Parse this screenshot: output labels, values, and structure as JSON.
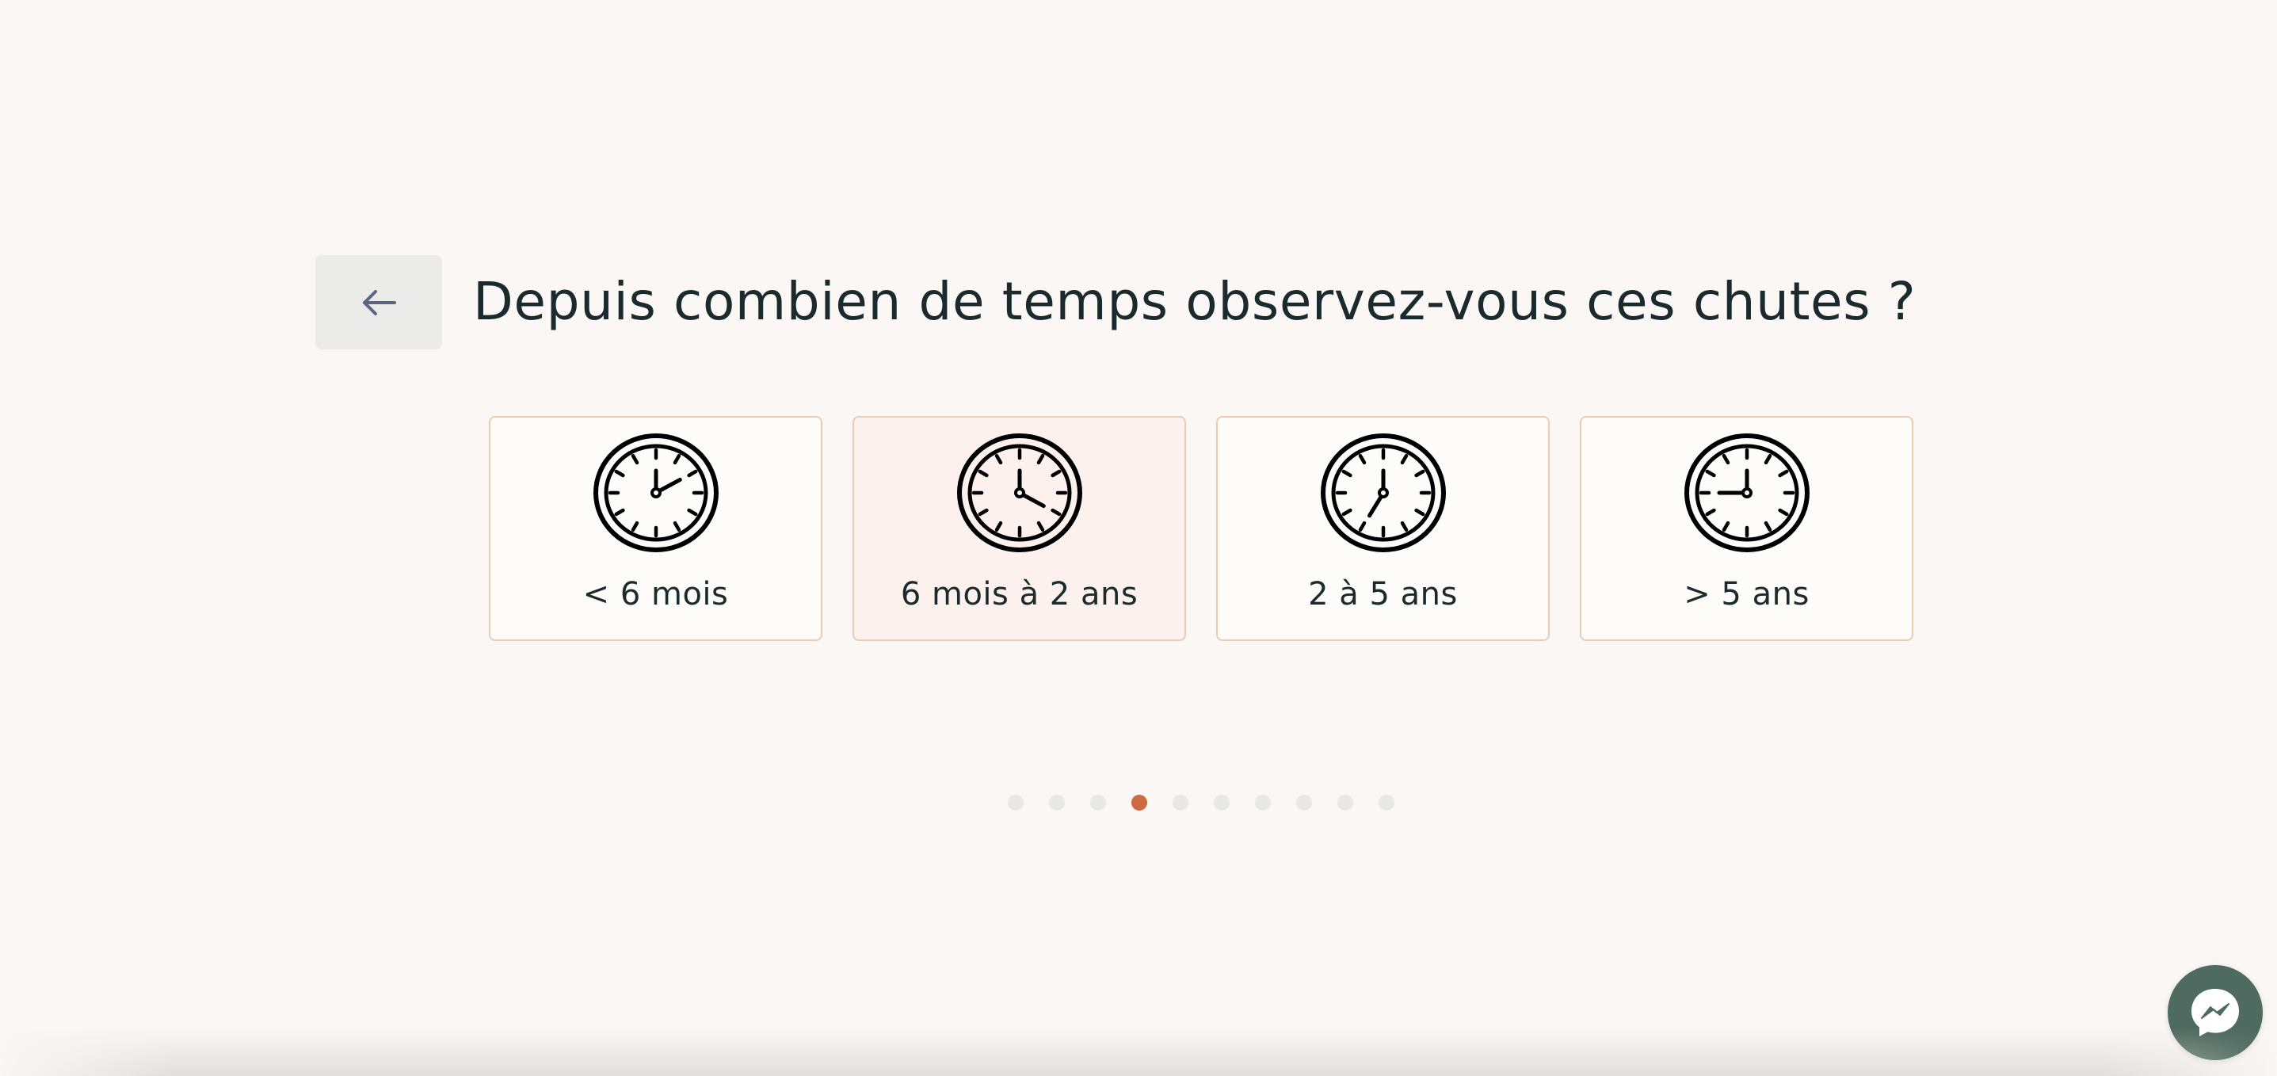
{
  "question": {
    "title": "Depuis combien de temps observez-vous ces chutes ?",
    "back_button": {
      "label": "Retour",
      "icon": "arrow-left-icon"
    }
  },
  "options": [
    {
      "label": "< 6 mois",
      "icon": "clock-icon",
      "selected": false,
      "clock_hour_hand": 2
    },
    {
      "label": "6 mois à 2 ans",
      "icon": "clock-icon",
      "selected": true,
      "clock_hour_hand": 4
    },
    {
      "label": "2 à 5 ans",
      "icon": "clock-icon",
      "selected": false,
      "clock_hour_hand": 7
    },
    {
      "label": "> 5 ans",
      "icon": "clock-icon",
      "selected": false,
      "clock_hour_hand": 9
    }
  ],
  "pagination": {
    "total_steps": 10,
    "current_step": 4
  },
  "chat": {
    "icon": "messenger-icon",
    "label": "Messenger"
  },
  "colors": {
    "background": "#fbf7f4",
    "accent": "#cd6a42",
    "card_border": "#ebcbb4",
    "card_selected_bg": "#fcf1ec",
    "dot_inactive": "#e8e8e7",
    "chat_bg": "#4f6a60",
    "text": "#1b2a2c",
    "back_arrow": "#5d6582"
  }
}
